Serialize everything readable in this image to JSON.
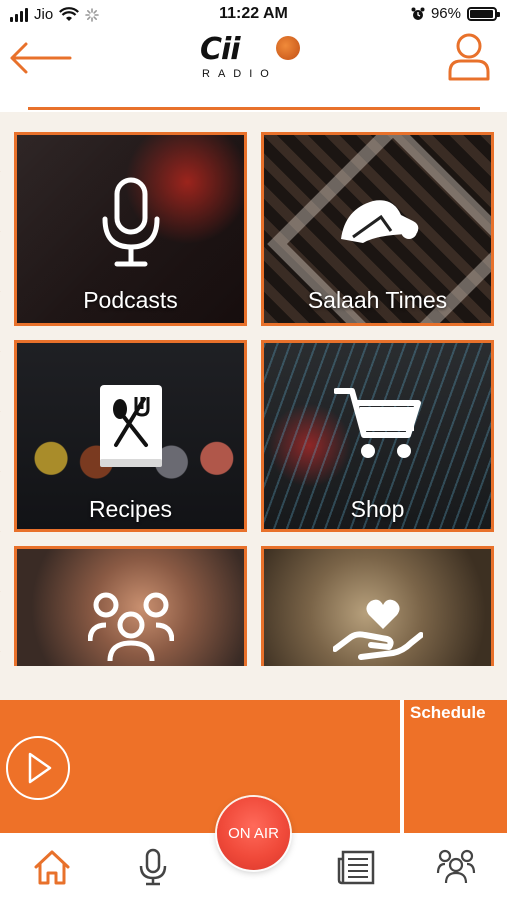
{
  "status_bar": {
    "carrier": "Jio",
    "time": "11:22 AM",
    "battery_percent": "96%",
    "battery_level": 0.96,
    "icons": [
      "signal-icon",
      "wifi-icon",
      "activity-spinner-icon",
      "alarm-icon",
      "battery-icon"
    ]
  },
  "header": {
    "logo_main": "Cii",
    "logo_sub": "RADIO",
    "back_icon": "arrow-left-icon",
    "profile_icon": "user-icon"
  },
  "tiles": [
    {
      "label": "Podcasts",
      "icon": "microphone-icon"
    },
    {
      "label": "Salaah Times",
      "icon": "prayer-icon"
    },
    {
      "label": "Recipes",
      "icon": "recipe-book-icon"
    },
    {
      "label": "Shop",
      "icon": "shopping-cart-icon"
    },
    {
      "label": "",
      "icon": "community-icon"
    },
    {
      "label": "",
      "icon": "charity-heart-hand-icon"
    }
  ],
  "player": {
    "schedule_label": "Schedule",
    "play_icon": "play-icon"
  },
  "bottom_nav": {
    "on_air_label": "ON AIR",
    "items": [
      "home-icon",
      "microphone-icon",
      "news-icon",
      "community-icon"
    ]
  },
  "colors": {
    "accent": "#ee7128",
    "on_air": "#f04a3a",
    "text_on_dark": "#ffffff"
  }
}
